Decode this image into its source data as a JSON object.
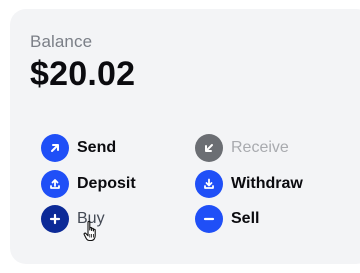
{
  "balance": {
    "label": "Balance",
    "amount": "$20.02"
  },
  "actions": [
    {
      "label": "Send",
      "icon": "arrow-up-right-icon",
      "enabled": true
    },
    {
      "label": "Receive",
      "icon": "arrow-down-left-icon",
      "enabled": false
    },
    {
      "label": "Deposit",
      "icon": "upload-tray-icon",
      "enabled": true
    },
    {
      "label": "Withdraw",
      "icon": "download-tray-icon",
      "enabled": true
    },
    {
      "label": "Buy",
      "icon": "plus-icon",
      "enabled": true,
      "hovered": true
    },
    {
      "label": "Sell",
      "icon": "minus-icon",
      "enabled": true
    }
  ],
  "colors": {
    "accent": "#1f4ff7",
    "accent_hover": "#0c2a97",
    "disabled": "#6b6e73",
    "card_bg": "#f3f4f6"
  }
}
